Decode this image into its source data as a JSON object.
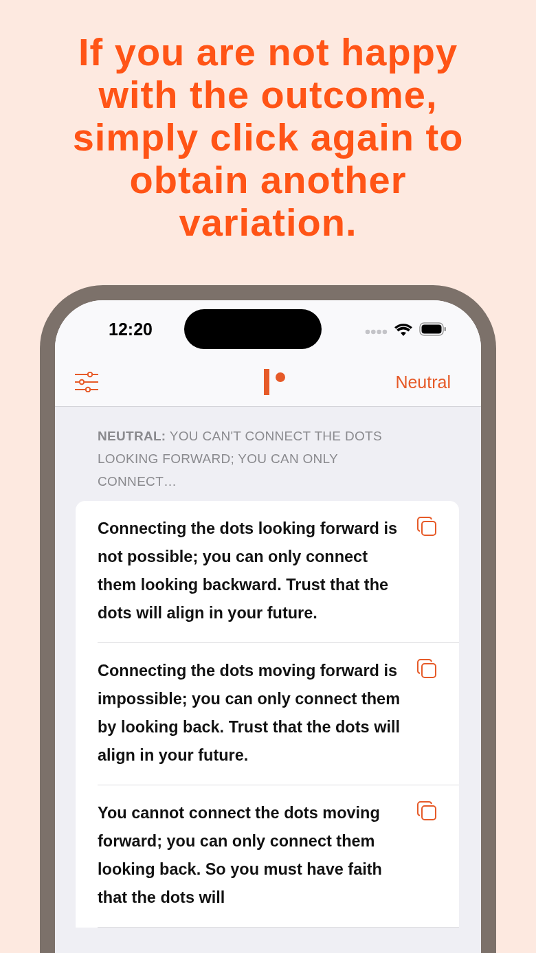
{
  "headline": "If you are not happy with the outcome, simply click again to obtain another variation.",
  "status_bar": {
    "time": "12:20"
  },
  "nav": {
    "tone_button": "Neutral"
  },
  "prompt": "**NEUTRAL:** YOU CAN'T CONNECT THE DOTS LOOKING FORWARD; YOU CAN ONLY CONNECT…",
  "results": [
    {
      "text": "Connecting the dots looking forward is not possible; you can only connect them looking backward. Trust that the dots will align in your future."
    },
    {
      "text": "Connecting the dots moving forward is impossible; you can only connect them by looking back. Trust that the dots will align in your future."
    },
    {
      "text": "You cannot connect the dots moving forward; you can only connect them looking back. So you must have faith that the dots will"
    }
  ]
}
